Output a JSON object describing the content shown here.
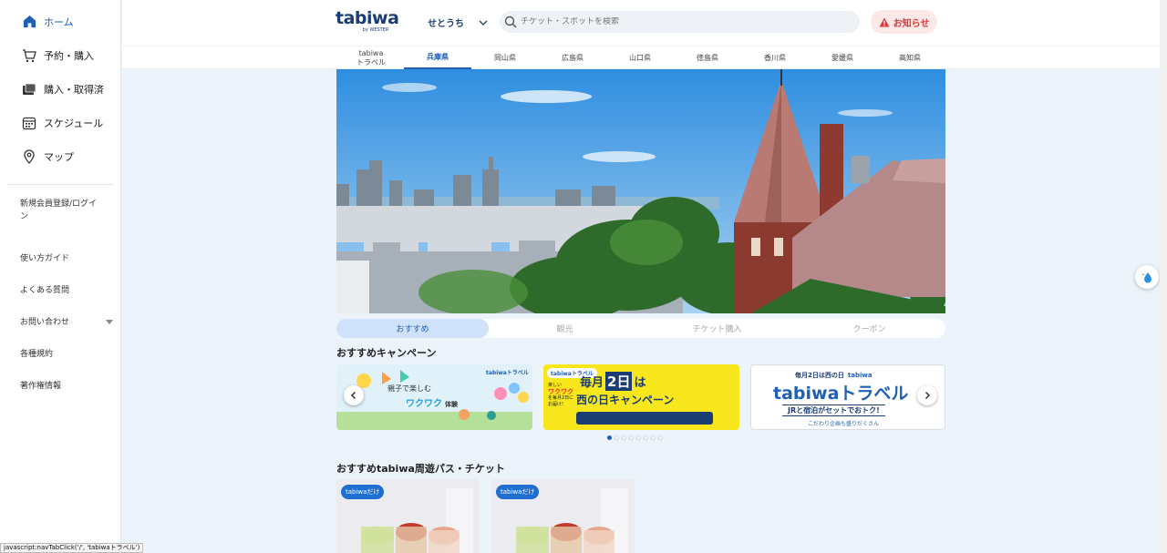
{
  "sidebar": {
    "nav": [
      {
        "label": "ホーム",
        "icon": "home-icon"
      },
      {
        "label": "予約・購入",
        "icon": "cart-icon"
      },
      {
        "label": "購入・取得済",
        "icon": "ticket-icon"
      },
      {
        "label": "スケジュール",
        "icon": "calendar-icon"
      },
      {
        "label": "マップ",
        "icon": "map-pin-icon"
      }
    ],
    "links": [
      {
        "label": "新規会員登録/ログイン"
      },
      {
        "label": "使い方ガイド"
      },
      {
        "label": "よくある質問"
      },
      {
        "label": "お問い合わせ"
      },
      {
        "label": "各種規約"
      },
      {
        "label": "著作権情報"
      }
    ]
  },
  "header": {
    "logo": "tabiwa",
    "logo_sub": "by WESTER",
    "region": "せとうち",
    "search_placeholder": "チケット・スポットを検索",
    "notice": "お知らせ"
  },
  "pref_tabs": [
    {
      "line1": "tabiwa",
      "line2": "トラベル"
    },
    {
      "line1": "兵庫県",
      "line2": ""
    },
    {
      "line1": "岡山県",
      "line2": ""
    },
    {
      "line1": "広島県",
      "line2": ""
    },
    {
      "line1": "山口県",
      "line2": ""
    },
    {
      "line1": "徳島県",
      "line2": ""
    },
    {
      "line1": "香川県",
      "line2": ""
    },
    {
      "line1": "愛媛県",
      "line2": ""
    },
    {
      "line1": "高知県",
      "line2": ""
    }
  ],
  "section_tabs": [
    "おすすめ",
    "観光",
    "チケット購入",
    "クーポン"
  ],
  "campaign": {
    "title": "おすすめキャンペーン",
    "banners": [
      {
        "brand": "tabiwaトラベル",
        "headline": "親子で楽しむ",
        "accent": "ワクワク",
        "tail": "体験"
      },
      {
        "brand": "tabiwaトラベル",
        "small1": "楽しい",
        "small2": "ワクワク",
        "small3": "を毎月2日に",
        "small4": "お届け!",
        "headline_a": "毎月",
        "headline_b": "2日",
        "headline_c": "は",
        "headline_d": "西の日キャンペーン"
      },
      {
        "top": "毎月2日は西の日",
        "brand_small": "tabiwa",
        "headline": "tabiwaトラベル",
        "sub": "JRと宿泊がセットでおトク!",
        "foot": "こだわり企画も盛りだくさん"
      }
    ]
  },
  "passes": {
    "title": "おすすめtabiwa周遊パス・チケット",
    "cards": [
      {
        "badge": "tabiwaだけ"
      },
      {
        "badge": "tabiwaだけ"
      }
    ]
  },
  "status_bar": "javascript:navTabClick('/', 'tabiwaトラベル')",
  "colors": {
    "accent": "#1f5fb4",
    "notice": "#d43b3b",
    "background": "#edf3fa"
  }
}
